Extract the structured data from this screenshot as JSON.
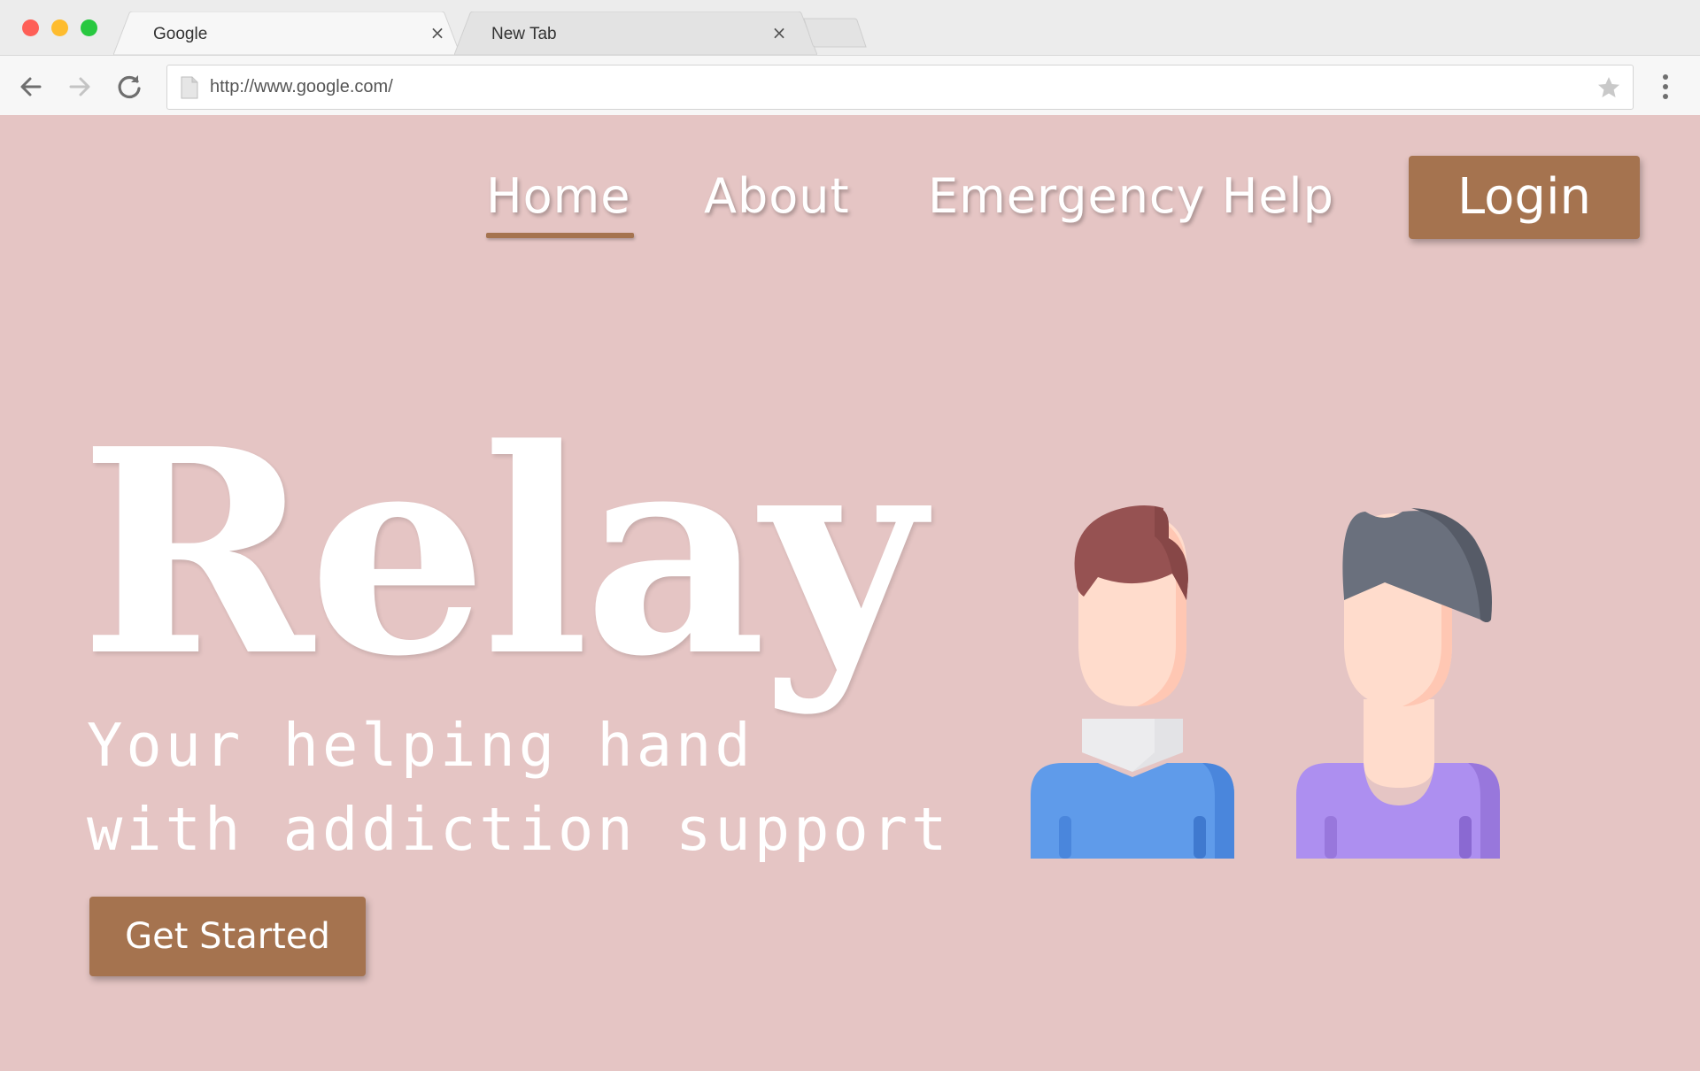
{
  "browser": {
    "tabs": [
      {
        "title": "Google",
        "active": true
      },
      {
        "title": "New Tab",
        "active": false
      }
    ],
    "close_glyph": "×",
    "url": "http://www.google.com/"
  },
  "site": {
    "nav": {
      "home": "Home",
      "about": "About",
      "emergency": "Emergency Help",
      "login": "Login"
    },
    "hero": {
      "title": "Relay",
      "tagline_line1": "Your helping hand",
      "tagline_line2": "with addiction support",
      "cta": "Get Started"
    }
  },
  "colors": {
    "page_background": "#e5c5c4",
    "accent_brown": "#a5734f",
    "text_white": "#ffffff"
  },
  "icons": [
    "back-arrow-icon",
    "forward-arrow-icon",
    "reload-icon",
    "page-icon",
    "bookmark-star-icon",
    "kebab-menu-icon",
    "person-avatar-icon"
  ]
}
